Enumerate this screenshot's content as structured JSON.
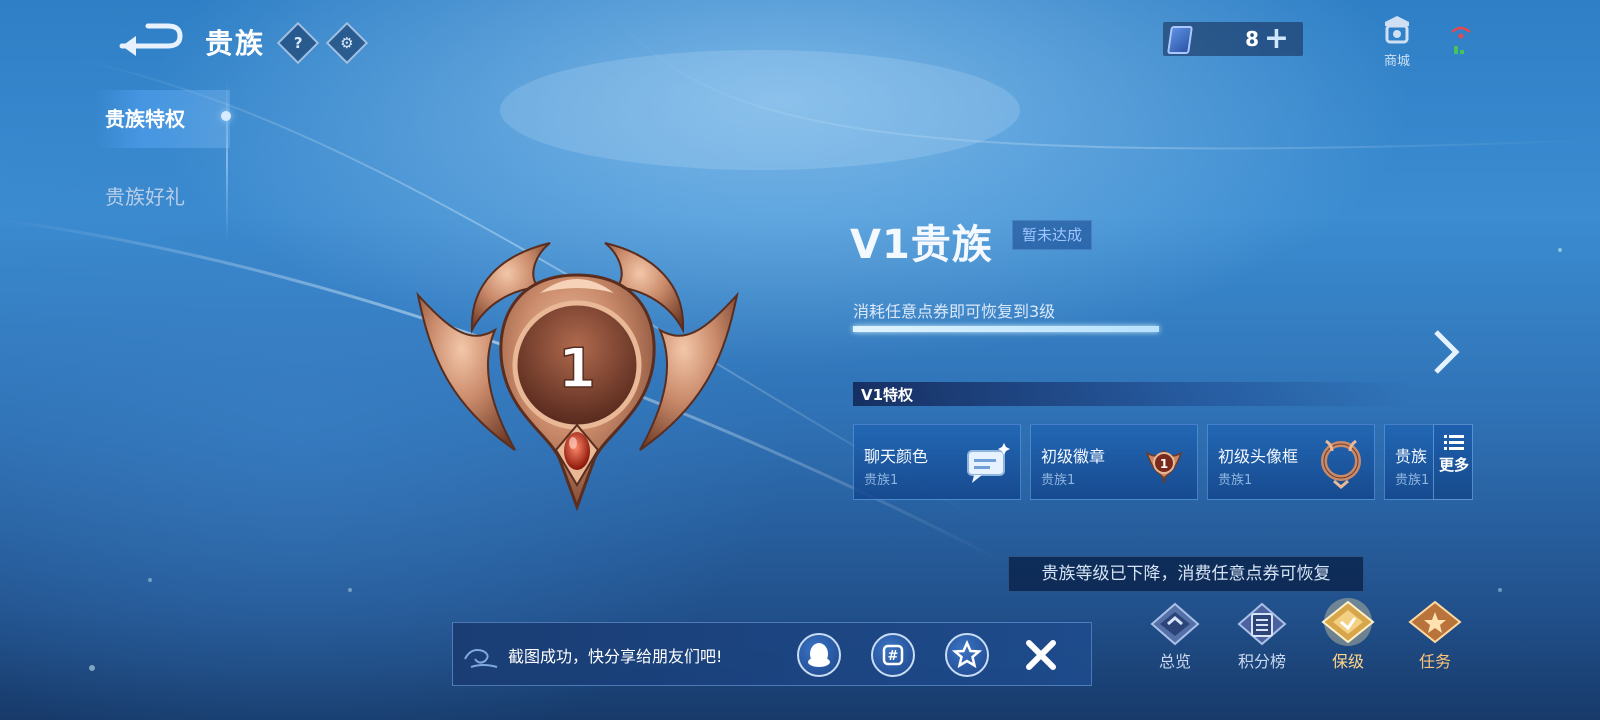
{
  "header": {
    "title": "贵族",
    "help_icon": "?",
    "voucher_count": "8",
    "voucher_plus": "+",
    "shop_label": "商城"
  },
  "sidebar": {
    "items": [
      {
        "label": "贵族特权",
        "active": true
      },
      {
        "label": "贵族好礼",
        "active": false
      }
    ]
  },
  "emblem": {
    "level_number": "1"
  },
  "vip": {
    "title": "V1贵族",
    "status": "暂未达成",
    "restore_hint": "消耗任意点券即可恢复到3级",
    "progress": 0.36
  },
  "privileges": {
    "header": "V1特权",
    "cards": [
      {
        "title": "聊天颜色",
        "sub": "贵族1",
        "icon": "chat-bubble-icon"
      },
      {
        "title": "初级徽章",
        "sub": "贵族1",
        "icon": "badge-icon"
      },
      {
        "title": "初级头像框",
        "sub": "贵族1",
        "icon": "avatar-frame-icon"
      },
      {
        "title": "贵族",
        "sub": "贵族1",
        "icon": ""
      }
    ],
    "more_label": "更多"
  },
  "tooltip": {
    "text": "贵族等级已下降，消费任意点券可恢复"
  },
  "bottom_nav": {
    "items": [
      {
        "label": "总览",
        "icon": "overview-icon"
      },
      {
        "label": "积分榜",
        "icon": "ranking-icon"
      },
      {
        "label": "保级",
        "icon": "protect-icon"
      },
      {
        "label": "任务",
        "icon": "task-icon"
      }
    ]
  },
  "share_toast": {
    "text": "截图成功，快分享给朋友们吧!",
    "buttons": [
      "qq-icon",
      "qzone-icon",
      "star-icon",
      "close-icon"
    ]
  },
  "colors": {
    "accent": "#3b8cd1",
    "bronze": "#c98a6a",
    "gold": "#ffc476"
  }
}
